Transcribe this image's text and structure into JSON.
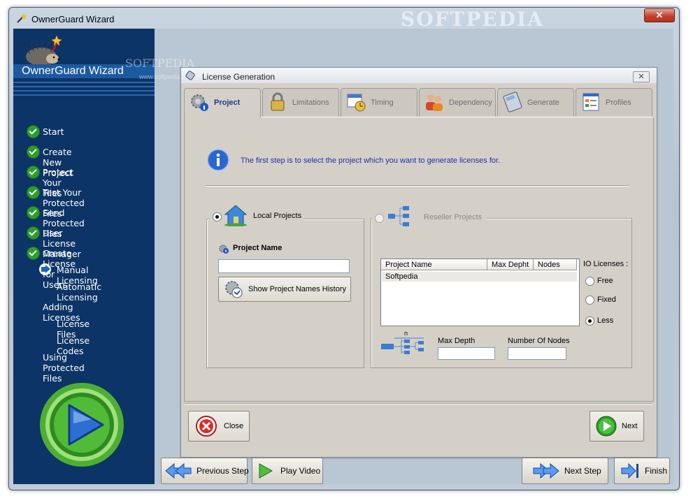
{
  "window": {
    "title": "OwnerGuard Wizard",
    "watermark": "SOFTPEDIA",
    "close_symbol": "✕"
  },
  "sidebar": {
    "brand": "OwnerGuard Wizard",
    "watermark": "SOFTPEDIA",
    "watermark_url": "www.softpedia.com",
    "steps": [
      {
        "label": "Start",
        "state": "done"
      },
      {
        "label": "Create New Project",
        "state": "done"
      },
      {
        "label": "Protect Your Files",
        "state": "done"
      },
      {
        "label": "Test Your Protected Files",
        "state": "done"
      },
      {
        "label": "Send Protected Files",
        "state": "done"
      },
      {
        "label": "User License Manager",
        "state": "done"
      },
      {
        "label": "Create License for Users",
        "state": "done"
      },
      {
        "label": "Manual Licensing",
        "state": "current"
      },
      {
        "label": "Automatic Licensing",
        "state": "pending"
      },
      {
        "label": "Adding Licenses",
        "state": "pending"
      },
      {
        "label": "License Files",
        "state": "pending"
      },
      {
        "label": "License Codes",
        "state": "pending"
      },
      {
        "label": "Using Protected Files",
        "state": "pending"
      }
    ]
  },
  "dialog": {
    "title": "License Generation",
    "close_symbol": "✕",
    "tabs": [
      {
        "label": "Project",
        "icon": "gear-info-icon",
        "active": true
      },
      {
        "label": "Limitations",
        "icon": "lock-icon",
        "active": false
      },
      {
        "label": "Timing",
        "icon": "calendar-clock-icon",
        "active": false
      },
      {
        "label": "Dependency",
        "icon": "users-icon",
        "active": false
      },
      {
        "label": "Generate",
        "icon": "calculator-icon",
        "active": false
      },
      {
        "label": "Profiles",
        "icon": "form-icon",
        "active": false
      }
    ],
    "info_text": "The first step is to select the project which you want to generate licenses for.",
    "local": {
      "radio_label": "Local Projects",
      "selected": true,
      "project_name_label": "Project Name",
      "project_name_value": "",
      "history_button": "Show Project Names History"
    },
    "reseller": {
      "radio_label": "Reseller Projects",
      "selected": false,
      "columns": [
        "Project Name",
        "Max Depht",
        "Nodes"
      ],
      "rows": [
        [
          "Softpedia",
          "",
          ""
        ]
      ],
      "io_licenses_label": "IO Licenses :",
      "io_options": [
        {
          "label": "Free",
          "selected": false
        },
        {
          "label": "Fixed",
          "selected": false
        },
        {
          "label": "Less",
          "selected": true
        }
      ],
      "tree_label": "n",
      "max_depth_label": "Max Depth",
      "max_depth_value": "",
      "nodes_label": "Number Of Nodes",
      "nodes_value": ""
    },
    "close_button": "Close",
    "next_button": "Next"
  },
  "nav": {
    "previous": "Previous Step",
    "play_video": "Play Video",
    "next_step": "Next Step",
    "finish": "Finish"
  },
  "colors": {
    "sidebar_bg": "#0c3466",
    "accent_blue": "#1933a8",
    "check_green": "#2c9d2c"
  }
}
